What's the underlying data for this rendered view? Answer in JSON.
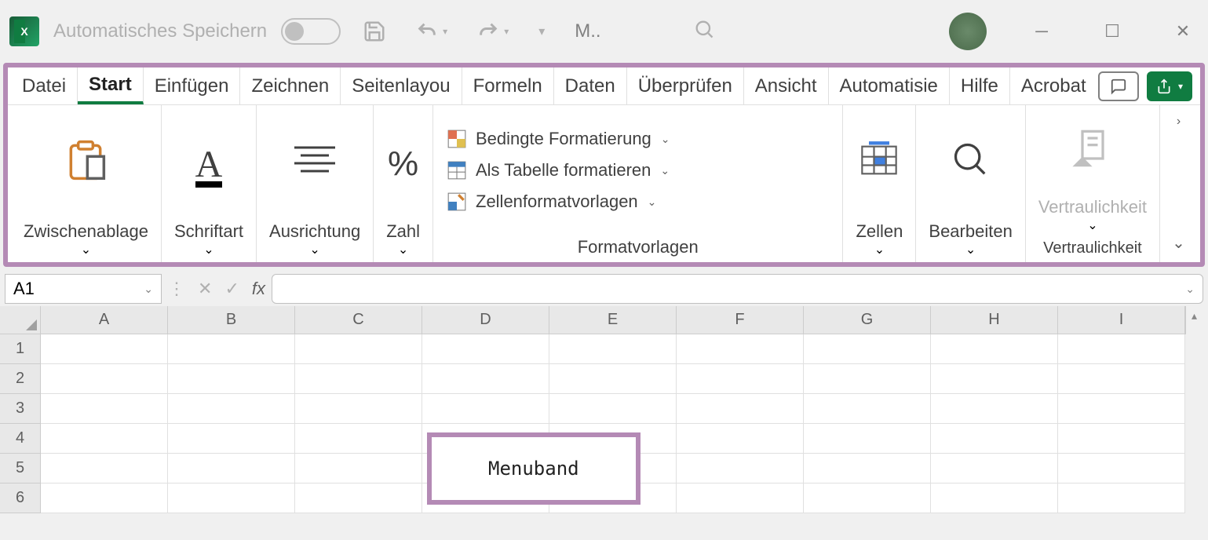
{
  "titlebar": {
    "autosave_label": "Automatisches Speichern",
    "doc_title_short": "M..",
    "search_glyph": "🔍"
  },
  "tabs": {
    "items": [
      {
        "label": "Datei"
      },
      {
        "label": "Start"
      },
      {
        "label": "Einfügen"
      },
      {
        "label": "Zeichnen"
      },
      {
        "label": "Seitenlayou"
      },
      {
        "label": "Formeln"
      },
      {
        "label": "Daten"
      },
      {
        "label": "Überprüfen"
      },
      {
        "label": "Ansicht"
      },
      {
        "label": "Automatisie"
      },
      {
        "label": "Hilfe"
      },
      {
        "label": "Acrobat"
      }
    ],
    "active_index": 1
  },
  "ribbon": {
    "clipboard": {
      "label": "Zwischenablage"
    },
    "font": {
      "label": "Schriftart"
    },
    "alignment": {
      "label": "Ausrichtung"
    },
    "number": {
      "label": "Zahl"
    },
    "styles": {
      "conditional": "Bedingte Formatierung",
      "as_table": "Als Tabelle formatieren",
      "cell_styles": "Zellenformatvorlagen",
      "footer": "Formatvorlagen"
    },
    "cells": {
      "label": "Zellen"
    },
    "editing": {
      "label": "Bearbeiten"
    },
    "sensitivity": {
      "label": "Vertraulichkeit",
      "footer": "Vertraulichkeit"
    }
  },
  "formula_bar": {
    "name_box": "A1",
    "fx": "fx"
  },
  "grid": {
    "columns": [
      "A",
      "B",
      "C",
      "D",
      "E",
      "F",
      "G",
      "H",
      "I"
    ],
    "rows": [
      "1",
      "2",
      "3",
      "4",
      "5",
      "6"
    ]
  },
  "callout": {
    "label": "Menuband"
  }
}
